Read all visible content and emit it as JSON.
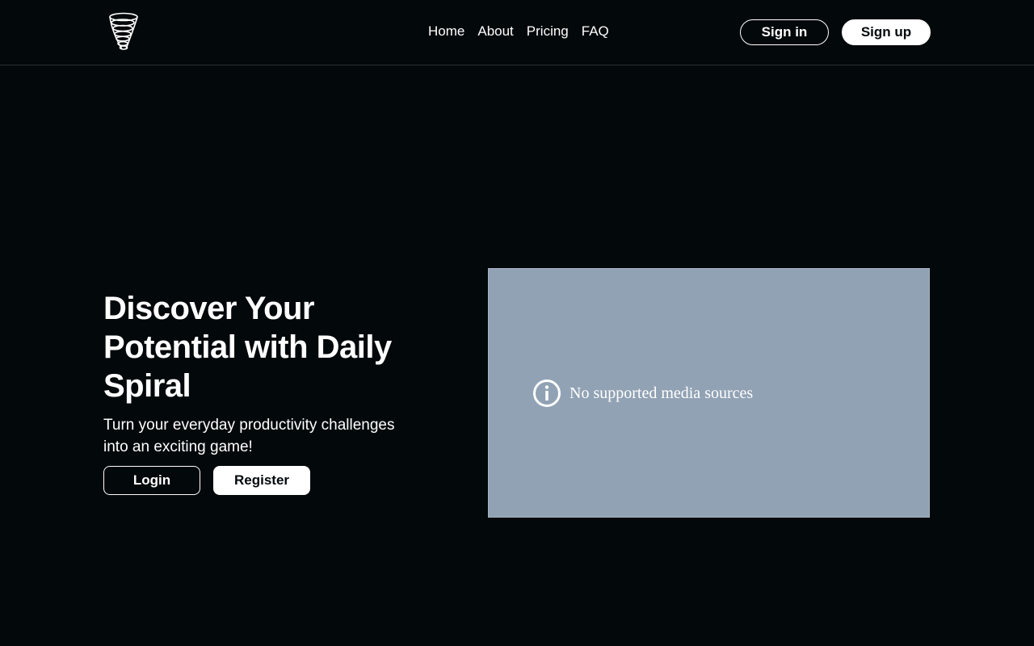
{
  "header": {
    "logo_icon": "spiral-tornado-logo",
    "nav": [
      {
        "label": "Home"
      },
      {
        "label": "About"
      },
      {
        "label": "Pricing"
      },
      {
        "label": "FAQ"
      }
    ],
    "signin_label": "Sign in",
    "signup_label": "Sign up"
  },
  "hero": {
    "title": "Discover Your Potential with Daily Spiral",
    "subtitle": "Turn your everyday productivity challenges into an exciting game!",
    "login_label": "Login",
    "register_label": "Register"
  },
  "media": {
    "icon": "info-icon",
    "message": "No supported media sources",
    "background": "#91a2b4"
  },
  "colors": {
    "background": "#03080b",
    "text": "#ffffff",
    "button_fill": "#ffffff"
  }
}
